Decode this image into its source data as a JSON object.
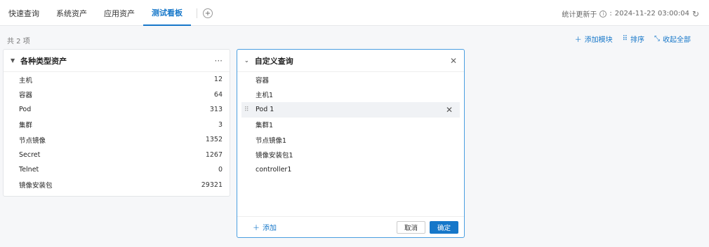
{
  "tabs": [
    {
      "label": "快速查询",
      "active": false
    },
    {
      "label": "系统资产",
      "active": false
    },
    {
      "label": "应用资产",
      "active": false
    },
    {
      "label": "测试看板",
      "active": true
    }
  ],
  "stat": {
    "label": "统计更新于",
    "time": "2024-11-22 03:00:04"
  },
  "count_text": "共 2 项",
  "actions": {
    "add_module": "添加模块",
    "sort": "排序",
    "collapse_all": "收起全部"
  },
  "panel1": {
    "title": "各种类型资产",
    "more": "···",
    "rows": [
      {
        "name": "主机",
        "value": "12"
      },
      {
        "name": "容器",
        "value": "64"
      },
      {
        "name": "Pod",
        "value": "313"
      },
      {
        "name": "集群",
        "value": "3"
      },
      {
        "name": "节点镜像",
        "value": "1352"
      },
      {
        "name": "Secret",
        "value": "1267"
      },
      {
        "name": "Telnet",
        "value": "0"
      },
      {
        "name": "镜像安装包",
        "value": "29321"
      }
    ]
  },
  "panel2": {
    "title": "自定义查询",
    "items": [
      "容器",
      "主机1",
      "Pod 1",
      "集群1",
      "节点镜像1",
      "镜像安装包1",
      "controller1"
    ],
    "add_label": "添加",
    "cancel_label": "取消",
    "ok_label": "确定"
  },
  "colors": {
    "accent": "#1677c9",
    "highlight": "#f0f2f5"
  }
}
